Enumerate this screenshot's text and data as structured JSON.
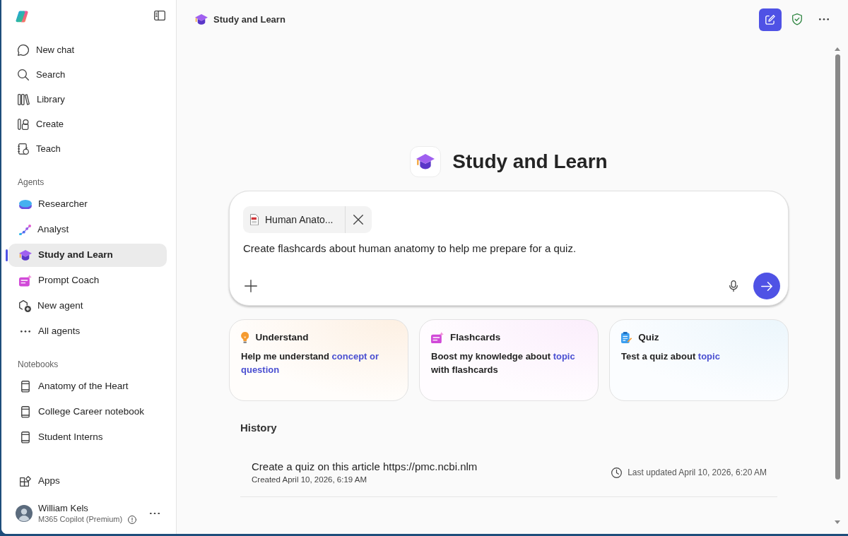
{
  "sidebar": {
    "nav_items": [
      {
        "kind": "chat",
        "label": "New chat",
        "selected": false
      },
      {
        "kind": "search",
        "label": "Search",
        "selected": false
      },
      {
        "kind": "library",
        "label": "Library",
        "selected": false
      },
      {
        "kind": "create",
        "label": "Create",
        "selected": false
      },
      {
        "kind": "teach",
        "label": "Teach",
        "selected": false
      }
    ],
    "agents": {
      "heading": "Agents",
      "items": [
        {
          "kind": "researcher",
          "label": "Researcher",
          "selected": false
        },
        {
          "kind": "analyst",
          "label": "Analyst",
          "selected": false
        },
        {
          "kind": "study",
          "label": "Study and Learn",
          "selected": true
        },
        {
          "kind": "coach",
          "label": "Prompt Coach",
          "selected": false
        },
        {
          "kind": "new_agent",
          "label": "New agent",
          "selected": false
        },
        {
          "kind": "all_agents",
          "label": "All agents",
          "selected": false
        }
      ]
    },
    "notebooks": {
      "heading": "Notebooks",
      "items": [
        {
          "label": "Anatomy of the Heart",
          "selected": false
        },
        {
          "label": "College Career notebook",
          "selected": false
        },
        {
          "label": "Student Interns",
          "selected": false
        }
      ]
    },
    "apps": {
      "label": "Apps"
    },
    "user": {
      "name": "William Kels",
      "plan": "M365 Copilot (Premium)"
    }
  },
  "header": {
    "title": "Study and Learn"
  },
  "hero": {
    "title": "Study and Learn"
  },
  "composer": {
    "attachment": {
      "name": "Human Anato..."
    },
    "value": "Create flashcards about human anatomy to help me prepare for a quiz."
  },
  "suggestions": [
    {
      "kind": "understand",
      "title": "Understand",
      "text": "Help me understand",
      "topic": "concept or question"
    },
    {
      "kind": "flashcards",
      "title": "Flashcards",
      "text": "Boost my knowledge about",
      "topic": "topic",
      "after": "with flashcards"
    },
    {
      "kind": "quiz",
      "title": "Quiz",
      "text": "Test a quiz about",
      "topic": "topic"
    }
  ],
  "history": {
    "heading": "History",
    "items": [
      {
        "title": "Create a quiz on this article https://pmc.ncbi.nlm",
        "created": "Created April 10, 2026, 6:19 AM",
        "updated": "Last updated April 10, 2026, 6:20 AM"
      }
    ]
  }
}
